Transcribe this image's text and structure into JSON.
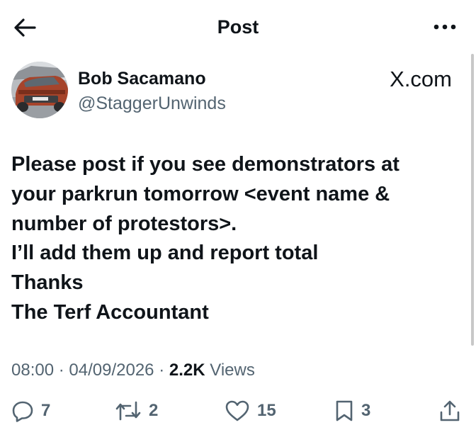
{
  "header": {
    "title": "Post",
    "back_icon": "arrow-left-icon",
    "more_icon": "more-horizontal-icon"
  },
  "post": {
    "author": {
      "name": "Bob Sacamano",
      "handle": "@StaggerUnwinds",
      "avatar_icon": "car-photo-avatar"
    },
    "watermark": "X.com",
    "text_lines": [
      "Please post if you see demonstrators at",
      "your parkrun tomorrow <event name &",
      "number of protestors>.",
      "I’ll add them up and report total",
      "Thanks",
      "The Terf Accountant"
    ],
    "meta": {
      "time": "08:00",
      "date": "04/09/2026",
      "views_count": "2.2K",
      "views_label": "Views",
      "separator": "·"
    },
    "actions": {
      "replies": "7",
      "reposts": "2",
      "likes": "15",
      "bookmarks": "3"
    }
  },
  "colors": {
    "text_primary": "#0f1419",
    "text_secondary": "#536471",
    "background": "#ffffff"
  }
}
